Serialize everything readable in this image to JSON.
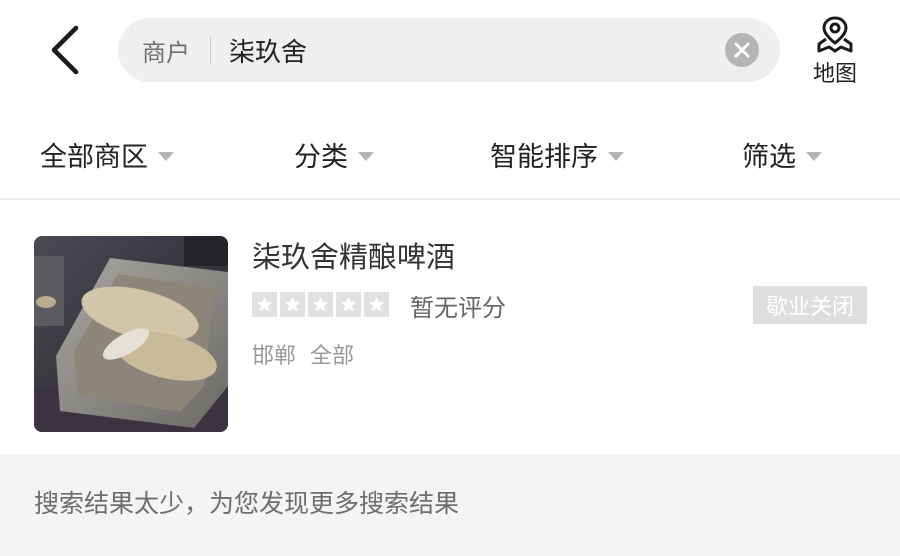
{
  "header": {
    "search": {
      "scope": "商户",
      "query": "柒玖舍"
    },
    "map_label": "地图"
  },
  "filters": [
    {
      "label": "全部商区"
    },
    {
      "label": "分类"
    },
    {
      "label": "智能排序"
    },
    {
      "label": "筛选"
    }
  ],
  "results": [
    {
      "name": "柒玖舍精酿啤酒",
      "rating_text": "暂无评分",
      "rating_stars": 0,
      "status": "歇业关闭",
      "city": "邯郸",
      "area": "全部"
    }
  ],
  "notice": "搜索结果太少，为您发现更多搜索结果",
  "colors": {
    "search_bg": "#efefef",
    "closed_badge_bg": "#dedede",
    "star_empty": "#e1e1e1",
    "notice_bg": "#f4f4f4"
  }
}
